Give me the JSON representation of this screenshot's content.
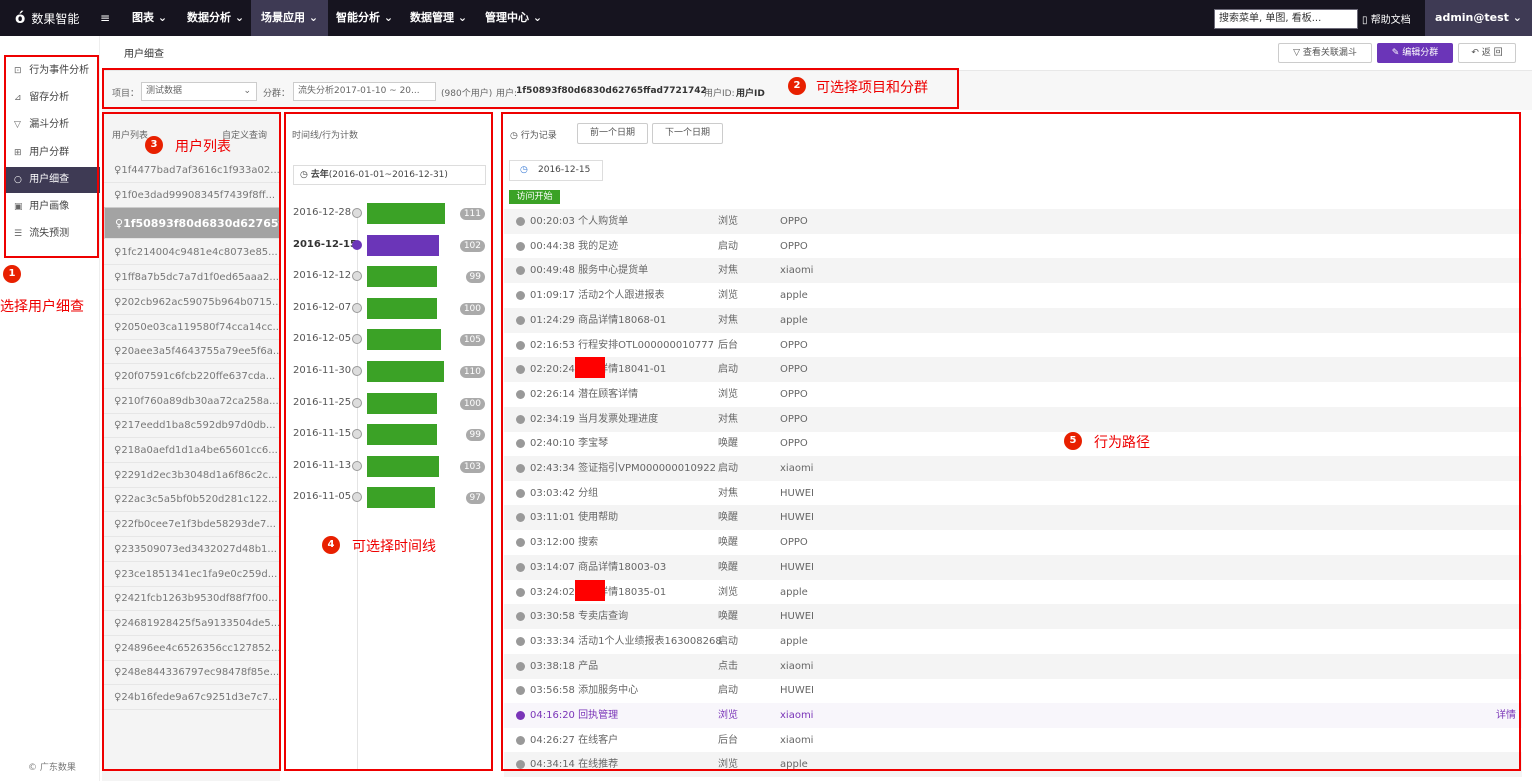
{
  "topbar": {
    "logo_mark": "ó",
    "logo_text": "数果智能",
    "menu_icon": "≡",
    "nav": [
      "图表 ⌄",
      "数据分析 ⌄",
      "场景应用 ⌄",
      "智能分析 ⌄",
      "数据管理 ⌄",
      "管理中心 ⌄"
    ],
    "search_placeholder": "搜索菜单, 单图, 看板...",
    "help": "帮助文档",
    "user": "admin@test ⌄"
  },
  "sidebar": {
    "items": [
      {
        "icon": "event-icon",
        "glyph": "⊡",
        "label": "行为事件分析"
      },
      {
        "icon": "retention-icon",
        "glyph": "⊿",
        "label": "留存分析"
      },
      {
        "icon": "funnel-icon",
        "glyph": "▽",
        "label": "漏斗分析"
      },
      {
        "icon": "segment-icon",
        "glyph": "⊞",
        "label": "用户分群"
      },
      {
        "icon": "search-icon",
        "glyph": "○",
        "label": "用户细查"
      },
      {
        "icon": "portrait-icon",
        "glyph": "▣",
        "label": "用户画像"
      },
      {
        "icon": "churn-icon",
        "glyph": "☰",
        "label": "流失预测"
      }
    ],
    "copyright": "© 广东数果"
  },
  "header": {
    "breadcrumb": "用户细查",
    "btn_funnel": "▽ 查看关联漏斗",
    "btn_edit": "✎ 编辑分群",
    "btn_back": "↶ 返 回"
  },
  "filter": {
    "project_label": "项目：",
    "project_value": "测试数据",
    "group_label": "分群：",
    "group_value": "流失分析2017-01-10 ~ 20...",
    "user_count": "(980个用户)",
    "user_label": "用户:",
    "user_value": "1f50893f80d6830d62765ffad7721742",
    "userid_label": "用户ID:",
    "userid_value": "用户ID"
  },
  "userlist": {
    "title": "用户列表",
    "custom": "自定义查询",
    "users": [
      "1f4477bad7af3616c1f933a02...",
      "1f0e3dad99908345f7439f8ff...",
      "1f50893f80d6830d62765f...",
      "1fc214004c9481e4c8073e85...",
      "1ff8a7b5dc7a7d1f0ed65aaa2...",
      "202cb962ac59075b964b0715...",
      "2050e03ca119580f74cca14cc...",
      "20aee3a5f4643755a79ee5f6a...",
      "20f07591c6fcb220ffe637cda...",
      "210f760a89db30aa72ca258a...",
      "217eedd1ba8c592db97d0db...",
      "218a0aefd1d1a4be65601cc6...",
      "2291d2ec3b3048d1a6f86c2c...",
      "22ac3c5a5bf0b520d281c122...",
      "22fb0cee7e1f3bde58293de7...",
      "233509073ed3432027d48b1...",
      "23ce1851341ec1fa9e0c259d...",
      "2421fcb1263b9530df88f7f00...",
      "24681928425f5a9133504de5...",
      "24896ee4c6526356cc127852...",
      "248e844336797ec98478f85e...",
      "24b16fede9a67c9251d3e7c7..."
    ]
  },
  "timeline": {
    "title": "时间线/行为计数",
    "range_bold": "去年",
    "range_rest": "(2016-01-01~2016-12-31)",
    "entries": [
      {
        "date": "2016-12-28",
        "count": 111
      },
      {
        "date": "2016-12-15",
        "count": 102
      },
      {
        "date": "2016-12-12",
        "count": 99
      },
      {
        "date": "2016-12-07",
        "count": 100
      },
      {
        "date": "2016-12-05",
        "count": 105
      },
      {
        "date": "2016-11-30",
        "count": 110
      },
      {
        "date": "2016-11-25",
        "count": 100
      },
      {
        "date": "2016-11-15",
        "count": 99
      },
      {
        "date": "2016-11-13",
        "count": 103
      },
      {
        "date": "2016-11-05",
        "count": 97
      }
    ]
  },
  "records": {
    "title": "行为记录",
    "prev": "前一个日期",
    "next": "下一个日期",
    "date": "2016-12-15",
    "start": "访问开始",
    "detail": "详情",
    "rows": [
      {
        "time": "00:20:03",
        "event": "个人购货单",
        "action": "浏览",
        "device": "OPPO"
      },
      {
        "time": "00:44:38",
        "event": "我的足迹",
        "action": "启动",
        "device": "OPPO"
      },
      {
        "time": "00:49:48",
        "event": "服务中心提货单",
        "action": "对焦",
        "device": "xiaomi"
      },
      {
        "time": "01:09:17",
        "event": "活动2个人跟进报表",
        "action": "浏览",
        "device": "apple"
      },
      {
        "time": "01:24:29",
        "event": "商品详情18068-01",
        "action": "对焦",
        "device": "apple"
      },
      {
        "time": "02:16:53",
        "event": "行程安排OTL000000010777",
        "action": "后台",
        "device": "OPPO"
      },
      {
        "time": "02:20:24",
        "event": "产品详情18041-01",
        "action": "启动",
        "device": "OPPO"
      },
      {
        "time": "02:26:14",
        "event": "潜在顾客详情",
        "action": "浏览",
        "device": "OPPO"
      },
      {
        "time": "02:34:19",
        "event": "当月发票处理进度",
        "action": "对焦",
        "device": "OPPO"
      },
      {
        "time": "02:40:10",
        "event": "李宝琴",
        "action": "唤醒",
        "device": "OPPO"
      },
      {
        "time": "02:43:34",
        "event": "签证指引VPM000000010922",
        "action": "启动",
        "device": "xiaomi"
      },
      {
        "time": "03:03:42",
        "event": "分组",
        "action": "对焦",
        "device": "HUWEI"
      },
      {
        "time": "03:11:01",
        "event": "使用帮助",
        "action": "唤醒",
        "device": "HUWEI"
      },
      {
        "time": "03:12:00",
        "event": "搜索",
        "action": "唤醒",
        "device": "OPPO"
      },
      {
        "time": "03:14:07",
        "event": "商品详情18003-03",
        "action": "唤醒",
        "device": "HUWEI"
      },
      {
        "time": "03:24:02",
        "event": "产品详情18035-01",
        "action": "浏览",
        "device": "apple"
      },
      {
        "time": "03:30:58",
        "event": "专卖店查询",
        "action": "唤醒",
        "device": "HUWEI"
      },
      {
        "time": "03:33:34",
        "event": "活动1个人业绩报表163008268",
        "action": "启动",
        "device": "apple"
      },
      {
        "time": "03:38:18",
        "event": "产品",
        "action": "点击",
        "device": "xiaomi"
      },
      {
        "time": "03:56:58",
        "event": "添加服务中心",
        "action": "启动",
        "device": "HUWEI"
      },
      {
        "time": "04:16:20",
        "event": "回执管理",
        "action": "浏览",
        "device": "xiaomi"
      },
      {
        "time": "04:26:27",
        "event": "在线客户",
        "action": "后台",
        "device": "xiaomi"
      },
      {
        "time": "04:34:14",
        "event": "在线推荐",
        "action": "浏览",
        "device": "apple"
      }
    ]
  },
  "annotations": [
    {
      "num": "1",
      "text": "选择用户细查"
    },
    {
      "num": "2",
      "text": "可选择项目和分群"
    },
    {
      "num": "3",
      "text": "用户列表"
    },
    {
      "num": "4",
      "text": "可选择时间线"
    },
    {
      "num": "5",
      "text": "行为路径"
    }
  ],
  "colors": {
    "accent": "#6b35b8",
    "bar": "#3ba226",
    "topbar": "#16141f",
    "annotation": "#e00000"
  }
}
